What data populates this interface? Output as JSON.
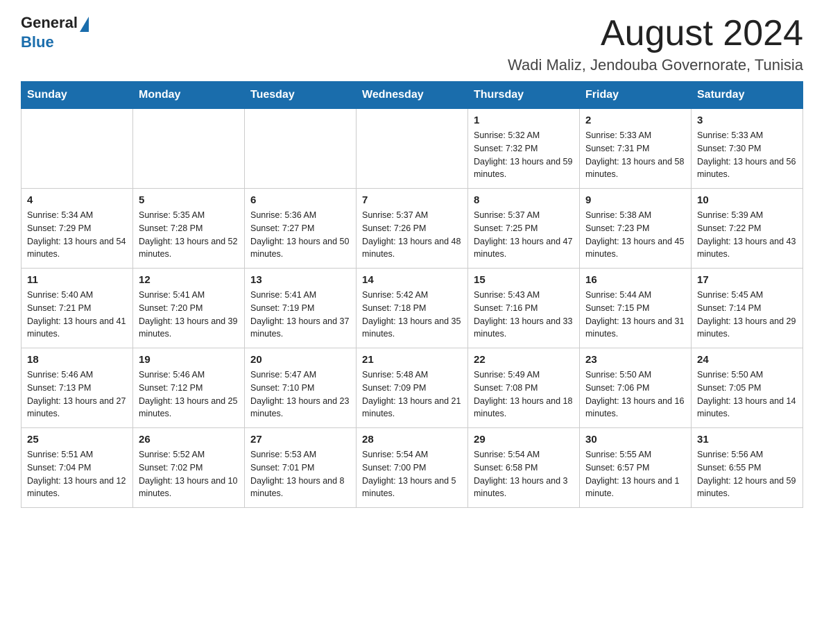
{
  "header": {
    "logo": {
      "text_general": "General",
      "text_blue": "Blue"
    },
    "month_title": "August 2024",
    "location": "Wadi Maliz, Jendouba Governorate, Tunisia"
  },
  "calendar": {
    "days_of_week": [
      "Sunday",
      "Monday",
      "Tuesday",
      "Wednesday",
      "Thursday",
      "Friday",
      "Saturday"
    ],
    "weeks": [
      [
        {
          "day": "",
          "info": ""
        },
        {
          "day": "",
          "info": ""
        },
        {
          "day": "",
          "info": ""
        },
        {
          "day": "",
          "info": ""
        },
        {
          "day": "1",
          "info": "Sunrise: 5:32 AM\nSunset: 7:32 PM\nDaylight: 13 hours and 59 minutes."
        },
        {
          "day": "2",
          "info": "Sunrise: 5:33 AM\nSunset: 7:31 PM\nDaylight: 13 hours and 58 minutes."
        },
        {
          "day": "3",
          "info": "Sunrise: 5:33 AM\nSunset: 7:30 PM\nDaylight: 13 hours and 56 minutes."
        }
      ],
      [
        {
          "day": "4",
          "info": "Sunrise: 5:34 AM\nSunset: 7:29 PM\nDaylight: 13 hours and 54 minutes."
        },
        {
          "day": "5",
          "info": "Sunrise: 5:35 AM\nSunset: 7:28 PM\nDaylight: 13 hours and 52 minutes."
        },
        {
          "day": "6",
          "info": "Sunrise: 5:36 AM\nSunset: 7:27 PM\nDaylight: 13 hours and 50 minutes."
        },
        {
          "day": "7",
          "info": "Sunrise: 5:37 AM\nSunset: 7:26 PM\nDaylight: 13 hours and 48 minutes."
        },
        {
          "day": "8",
          "info": "Sunrise: 5:37 AM\nSunset: 7:25 PM\nDaylight: 13 hours and 47 minutes."
        },
        {
          "day": "9",
          "info": "Sunrise: 5:38 AM\nSunset: 7:23 PM\nDaylight: 13 hours and 45 minutes."
        },
        {
          "day": "10",
          "info": "Sunrise: 5:39 AM\nSunset: 7:22 PM\nDaylight: 13 hours and 43 minutes."
        }
      ],
      [
        {
          "day": "11",
          "info": "Sunrise: 5:40 AM\nSunset: 7:21 PM\nDaylight: 13 hours and 41 minutes."
        },
        {
          "day": "12",
          "info": "Sunrise: 5:41 AM\nSunset: 7:20 PM\nDaylight: 13 hours and 39 minutes."
        },
        {
          "day": "13",
          "info": "Sunrise: 5:41 AM\nSunset: 7:19 PM\nDaylight: 13 hours and 37 minutes."
        },
        {
          "day": "14",
          "info": "Sunrise: 5:42 AM\nSunset: 7:18 PM\nDaylight: 13 hours and 35 minutes."
        },
        {
          "day": "15",
          "info": "Sunrise: 5:43 AM\nSunset: 7:16 PM\nDaylight: 13 hours and 33 minutes."
        },
        {
          "day": "16",
          "info": "Sunrise: 5:44 AM\nSunset: 7:15 PM\nDaylight: 13 hours and 31 minutes."
        },
        {
          "day": "17",
          "info": "Sunrise: 5:45 AM\nSunset: 7:14 PM\nDaylight: 13 hours and 29 minutes."
        }
      ],
      [
        {
          "day": "18",
          "info": "Sunrise: 5:46 AM\nSunset: 7:13 PM\nDaylight: 13 hours and 27 minutes."
        },
        {
          "day": "19",
          "info": "Sunrise: 5:46 AM\nSunset: 7:12 PM\nDaylight: 13 hours and 25 minutes."
        },
        {
          "day": "20",
          "info": "Sunrise: 5:47 AM\nSunset: 7:10 PM\nDaylight: 13 hours and 23 minutes."
        },
        {
          "day": "21",
          "info": "Sunrise: 5:48 AM\nSunset: 7:09 PM\nDaylight: 13 hours and 21 minutes."
        },
        {
          "day": "22",
          "info": "Sunrise: 5:49 AM\nSunset: 7:08 PM\nDaylight: 13 hours and 18 minutes."
        },
        {
          "day": "23",
          "info": "Sunrise: 5:50 AM\nSunset: 7:06 PM\nDaylight: 13 hours and 16 minutes."
        },
        {
          "day": "24",
          "info": "Sunrise: 5:50 AM\nSunset: 7:05 PM\nDaylight: 13 hours and 14 minutes."
        }
      ],
      [
        {
          "day": "25",
          "info": "Sunrise: 5:51 AM\nSunset: 7:04 PM\nDaylight: 13 hours and 12 minutes."
        },
        {
          "day": "26",
          "info": "Sunrise: 5:52 AM\nSunset: 7:02 PM\nDaylight: 13 hours and 10 minutes."
        },
        {
          "day": "27",
          "info": "Sunrise: 5:53 AM\nSunset: 7:01 PM\nDaylight: 13 hours and 8 minutes."
        },
        {
          "day": "28",
          "info": "Sunrise: 5:54 AM\nSunset: 7:00 PM\nDaylight: 13 hours and 5 minutes."
        },
        {
          "day": "29",
          "info": "Sunrise: 5:54 AM\nSunset: 6:58 PM\nDaylight: 13 hours and 3 minutes."
        },
        {
          "day": "30",
          "info": "Sunrise: 5:55 AM\nSunset: 6:57 PM\nDaylight: 13 hours and 1 minute."
        },
        {
          "day": "31",
          "info": "Sunrise: 5:56 AM\nSunset: 6:55 PM\nDaylight: 12 hours and 59 minutes."
        }
      ]
    ]
  }
}
